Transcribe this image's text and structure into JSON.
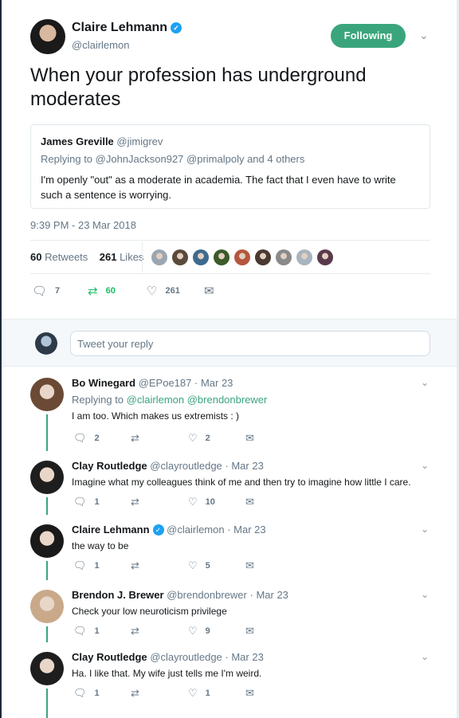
{
  "main_tweet": {
    "author_name": "Claire Lehmann",
    "verified_mark": "✓",
    "handle": "@clairlemon",
    "follow_label": "Following",
    "text": "When your profession has underground moderates",
    "quote": {
      "name": "James Greville",
      "handle": "@jimigrev",
      "replying_to": "Replying to @JohnJackson927 @primalpoly and 4 others",
      "text": "I'm openly \"out\" as a moderate in academia. The fact that I even have to write such a sentence is worrying."
    },
    "timestamp": "9:39 PM - 23 Mar 2018",
    "retweets_count": "60",
    "retweets_label": "Retweets",
    "likes_count": "261",
    "likes_label": "Likes",
    "actions": {
      "replies": "7",
      "retweets": "60",
      "likes": "261"
    },
    "liker_avatar_colors": [
      "#9aa7b3",
      "#5b4a3c",
      "#3d6b8f",
      "#3c5a2a",
      "#b5573e",
      "#4a3a30",
      "#8a8a8a",
      "#a8b4c0",
      "#5a3a4a"
    ]
  },
  "composer": {
    "placeholder": "Tweet your reply"
  },
  "replies": [
    {
      "name": "Bo Winegard",
      "handle": "@EPoe187",
      "date": "· Mar 23",
      "replying_label": "Replying to",
      "replying_users": "@clairlemon @brendonbrewer",
      "text": "I am too. Which makes us extremists : )",
      "replies": "2",
      "retweets": "",
      "likes": "2",
      "avatar_color": "#6b4a35"
    },
    {
      "name": "Clay Routledge",
      "handle": "@clayroutledge",
      "date": "· Mar 23",
      "text": "Imagine what my colleagues think of me and then try to imagine how little I care.",
      "replies": "1",
      "retweets": "",
      "likes": "10",
      "avatar_color": "#1e1e1e"
    },
    {
      "name": "Claire Lehmann",
      "handle": "@clairlemon",
      "date": "· Mar 23",
      "text": "the way to be",
      "replies": "1",
      "retweets": "",
      "likes": "5",
      "avatar_color": "#1a1a1a"
    },
    {
      "name": "Brendon J. Brewer",
      "handle": "@brendonbrewer",
      "date": "· Mar 23",
      "text": "Check your low neuroticism privilege",
      "replies": "1",
      "retweets": "",
      "likes": "9",
      "avatar_color": "#c9a98a"
    },
    {
      "name": "Clay Routledge",
      "handle": "@clayroutledge",
      "date": "· Mar 23",
      "text": "Ha. I like that. My wife just tells me I'm weird.",
      "replies": "1",
      "retweets": "",
      "likes": "1",
      "avatar_color": "#1e1e1e"
    }
  ],
  "icons": {
    "reply": "reply-icon",
    "retweet": "retweet-icon",
    "like": "heart-icon",
    "dm": "envelope-icon",
    "chevron": "chevron-down-icon",
    "verified": "verified-icon"
  },
  "colors": {
    "accent": "#3aa57c",
    "link_blue": "#1da1f2",
    "muted": "#657786"
  }
}
